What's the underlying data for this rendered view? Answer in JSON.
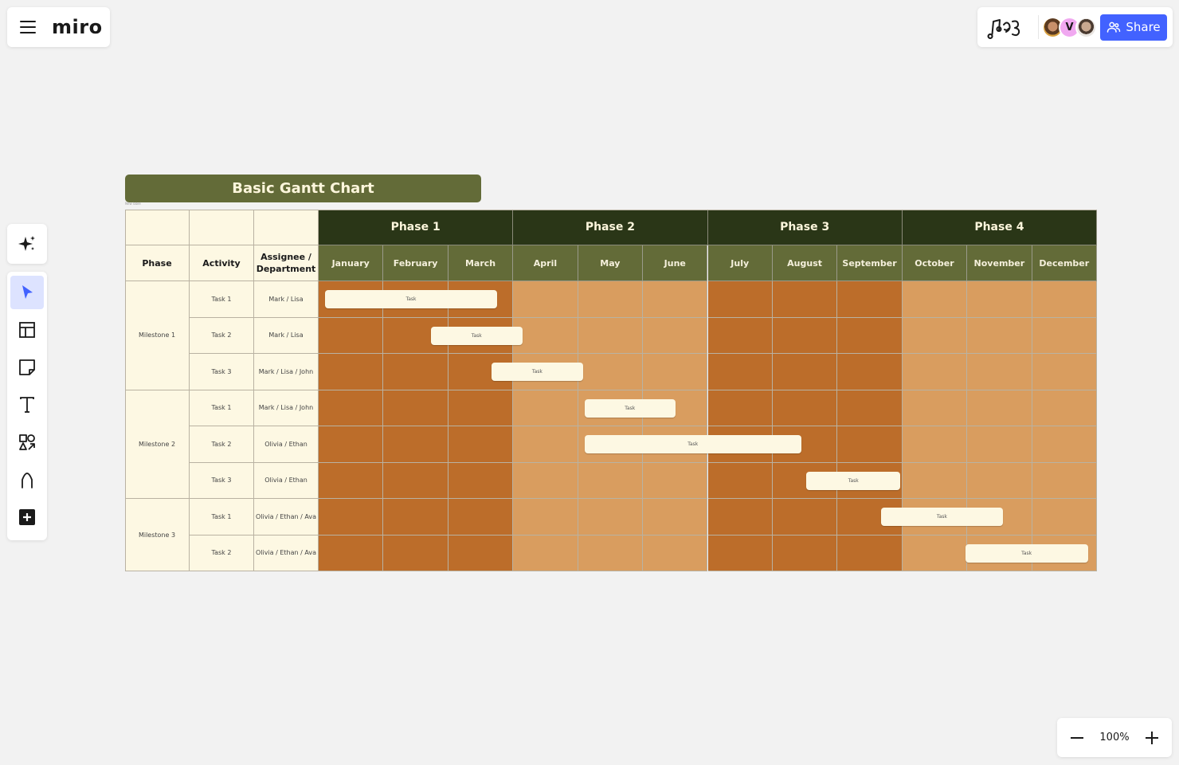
{
  "header": {
    "logo": "miro",
    "menu_icon": "hamburger-icon",
    "app_icon": "jam-app-icon",
    "collaborators": [
      {
        "name": "collaborator-1",
        "initial": ""
      },
      {
        "name": "collaborator-v",
        "initial": "V"
      },
      {
        "name": "collaborator-3",
        "initial": ""
      }
    ],
    "share_label": "Share"
  },
  "toolbar": {
    "ai_icon": "sparkle-icon",
    "tools": [
      {
        "name": "select",
        "icon": "cursor-icon",
        "active": true
      },
      {
        "name": "templates",
        "icon": "template-icon",
        "active": false
      },
      {
        "name": "sticky-note",
        "icon": "sticky-note-icon",
        "active": false
      },
      {
        "name": "text",
        "icon": "text-icon",
        "active": false
      },
      {
        "name": "shapes",
        "icon": "shapes-icon",
        "active": false
      },
      {
        "name": "pen",
        "icon": "pen-icon",
        "active": false
      },
      {
        "name": "more",
        "icon": "plus-square-icon",
        "active": false
      }
    ]
  },
  "zoom": {
    "level": "100%"
  },
  "gantt": {
    "title": "Basic Gantt Chart",
    "small_label": "New label",
    "headers": {
      "phase": "Phase",
      "activity": "Activity",
      "assignee": "Assignee / Department"
    },
    "phases": [
      "Phase 1",
      "Phase 2",
      "Phase 3",
      "Phase 4"
    ],
    "months": [
      "January",
      "February",
      "March",
      "April",
      "May",
      "June",
      "July",
      "August",
      "September",
      "October",
      "November",
      "December"
    ],
    "milestones": [
      {
        "label": "Milestone 1",
        "rows": 3
      },
      {
        "label": "Milestone 2",
        "rows": 3
      },
      {
        "label": "Milestone 3",
        "rows": 2
      }
    ],
    "rows": [
      {
        "activity": "Task 1",
        "assignee": "Mark / Lisa",
        "bar_label": "Task",
        "start_month": 0.1,
        "end_month": 2.75
      },
      {
        "activity": "Task 2",
        "assignee": "Mark / Lisa",
        "bar_label": "Task",
        "start_month": 1.73,
        "end_month": 3.14
      },
      {
        "activity": "Task 3",
        "assignee": "Mark / Lisa / John",
        "bar_label": "Task",
        "start_month": 2.66,
        "end_month": 4.08
      },
      {
        "activity": "Task 1",
        "assignee": "Mark / Lisa / John",
        "bar_label": "Task",
        "start_month": 4.1,
        "end_month": 5.5
      },
      {
        "activity": "Task 2",
        "assignee": "Olivia / Ethan",
        "bar_label": "Task",
        "start_month": 4.1,
        "end_month": 7.44
      },
      {
        "activity": "Task 3",
        "assignee": "Olivia / Ethan",
        "bar_label": "Task",
        "start_month": 7.52,
        "end_month": 8.97
      },
      {
        "activity": "Task 1",
        "assignee": "Olivia / Ethan / Ava",
        "bar_label": "Task",
        "start_month": 8.67,
        "end_month": 10.55
      },
      {
        "activity": "Task 2",
        "assignee": "Olivia / Ethan / Ava",
        "bar_label": "Task",
        "start_month": 9.97,
        "end_month": 11.86
      }
    ],
    "colors": {
      "phase_header": "#2a3617",
      "month_header": "#636b38",
      "phase_odd_fill": "#bc6d2a",
      "phase_even_fill": "#d99d5f",
      "left_fill": "#fdf8e3",
      "bar_fill": "#fdf8e3"
    }
  }
}
